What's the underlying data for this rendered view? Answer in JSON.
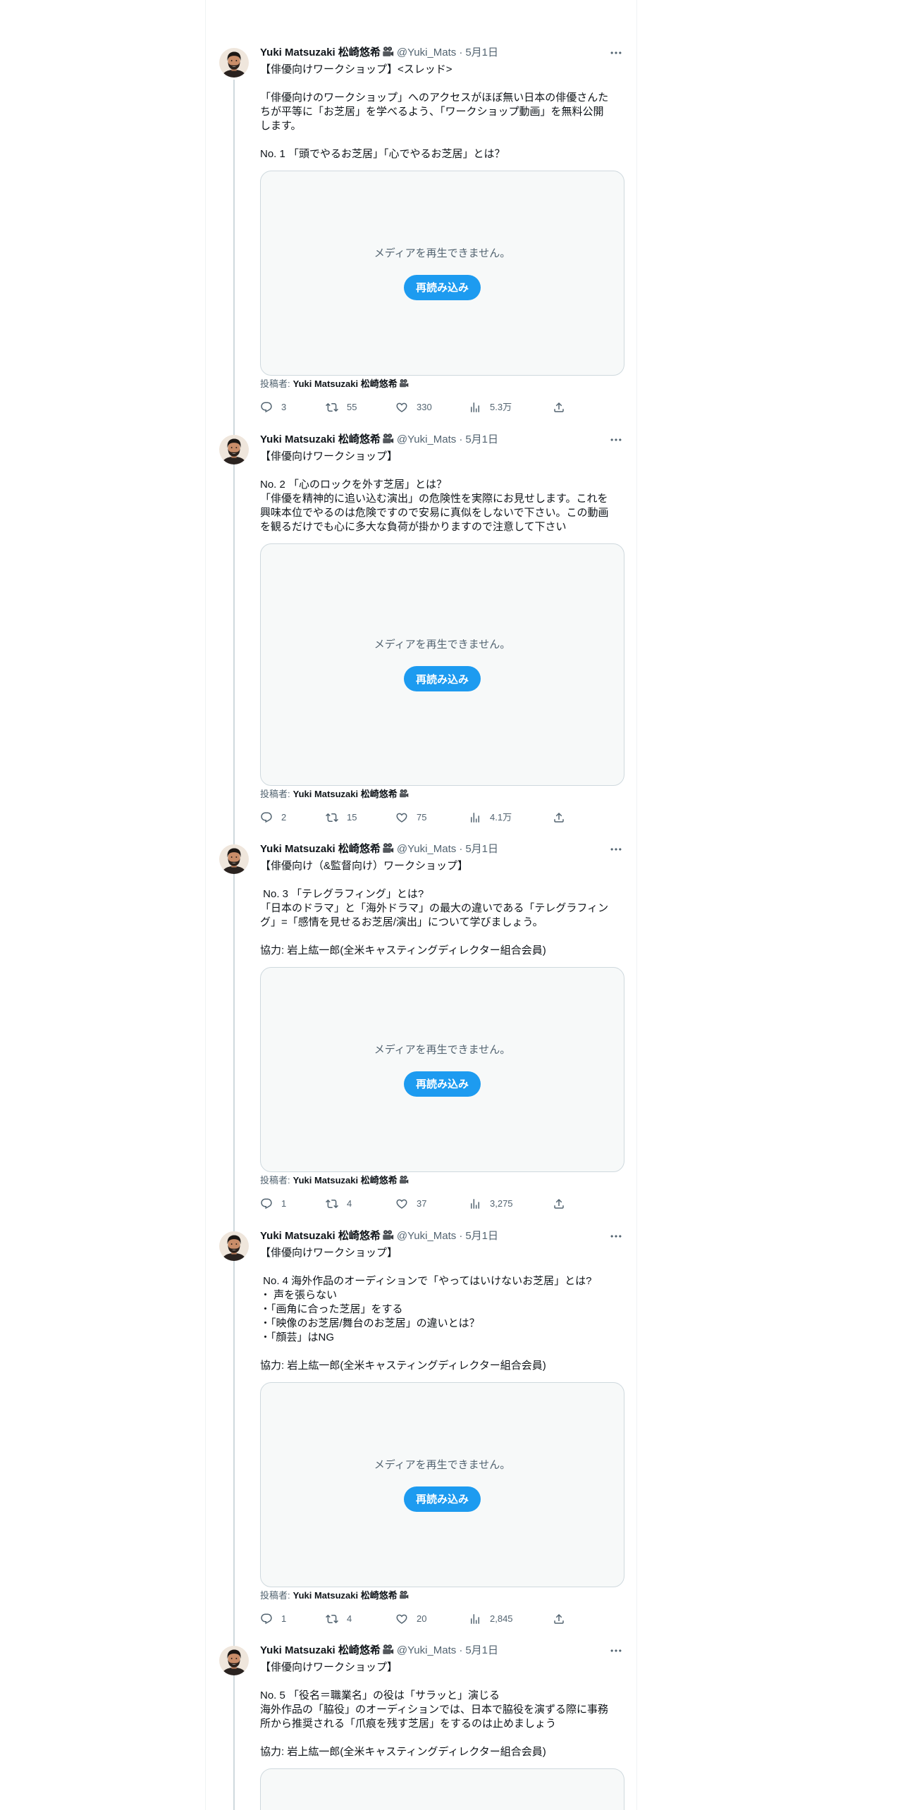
{
  "author": {
    "name": "Yuki Matsuzaki 松崎悠希",
    "name_icon": "film-projector-icon",
    "handle": "@Yuki_Mats",
    "separator": "·"
  },
  "colors": {
    "text": "#0f1419",
    "secondary": "#536471",
    "accent": "#1d9bf0",
    "thread_line": "#cfd9de",
    "media_background": "#f7f9f9"
  },
  "tweets": [
    {
      "date": "5月1日",
      "lines": [
        "【俳優向けワークショップ】<スレッド>",
        "",
        "「俳優向けのワークショップ」へのアクセスがほぼ無い日本の俳優さんた",
        "ちが平等に「お芝居」を学べるよう、「ワークショップ動画」を無料公開",
        "します。",
        "",
        "No. 1 「頭でやるお芝居」「心でやるお芝居」とは？"
      ],
      "media": {
        "message": "メディアを再生できません。",
        "button": "再読み込み"
      },
      "attribution": {
        "label": "投稿者:",
        "name": "Yuki Matsuzaki 松崎悠希"
      },
      "counts": {
        "replies": "3",
        "retweets": "55",
        "likes": "330",
        "views": "5.3万"
      }
    },
    {
      "date": "5月1日",
      "lines": [
        "【俳優向けワークショップ】",
        "",
        "No. 2 「心のロックを外す芝居」とは？",
        "「俳優を精神的に追い込む演出」の危険性を実際にお見せします。これを",
        "興味本位でやるのは危険ですので安易に真似をしないで下さい。この動画",
        "を観るだけでも心に多大な負荷が掛かりますので注意して下さい"
      ],
      "media": {
        "message": "メディアを再生できません。",
        "button": "再読み込み"
      },
      "attribution": {
        "label": "投稿者:",
        "name": "Yuki Matsuzaki 松崎悠希"
      },
      "counts": {
        "replies": "2",
        "retweets": "15",
        "likes": "75",
        "views": "4.1万"
      }
    },
    {
      "date": "5月1日",
      "lines": [
        "【俳優向け（&監督向け）ワークショップ】",
        "",
        " No. 3 「テレグラフィング」とは?",
        "「日本のドラマ」と「海外ドラマ」の最大の違いである「テレグラフィン",
        "グ」=「感情を見せるお芝居/演出」について学びましょう。",
        "",
        "協力: 岩上紘一郎(全米キャスティングディレクター組合会員)"
      ],
      "media": {
        "message": "メディアを再生できません。",
        "button": "再読み込み"
      },
      "attribution": {
        "label": "投稿者:",
        "name": "Yuki Matsuzaki 松崎悠希"
      },
      "counts": {
        "replies": "1",
        "retweets": "4",
        "likes": "37",
        "views": "3,275"
      }
    },
    {
      "date": "5月1日",
      "lines": [
        "【俳優向けワークショップ】",
        "",
        " No. 4 海外作品のオーディションで「やってはいけないお芝居」とは?",
        "・ 声を張らない",
        "・「画角に合った芝居」をする",
        "・「映像のお芝居/舞台のお芝居」の違いとは？",
        "・「顔芸」はNG",
        "",
        "協力: 岩上紘一郎(全米キャスティングディレクター組合会員)"
      ],
      "media": {
        "message": "メディアを再生できません。",
        "button": "再読み込み"
      },
      "attribution": {
        "label": "投稿者:",
        "name": "Yuki Matsuzaki 松崎悠希"
      },
      "counts": {
        "replies": "1",
        "retweets": "4",
        "likes": "20",
        "views": "2,845"
      }
    },
    {
      "date": "5月1日",
      "lines": [
        "【俳優向けワークショップ】",
        "",
        "No. 5 「役名＝職業名」の役は「サラッと」演じる",
        "海外作品の「脇役」のオーディションでは、日本で脇役を演ずる際に事務",
        "所から推奨される「爪痕を残す芝居」をするのは止めましょう",
        "",
        "協力: 岩上紘一郎(全米キャスティングディレクター組合会員)"
      ],
      "media": {}
    }
  ]
}
